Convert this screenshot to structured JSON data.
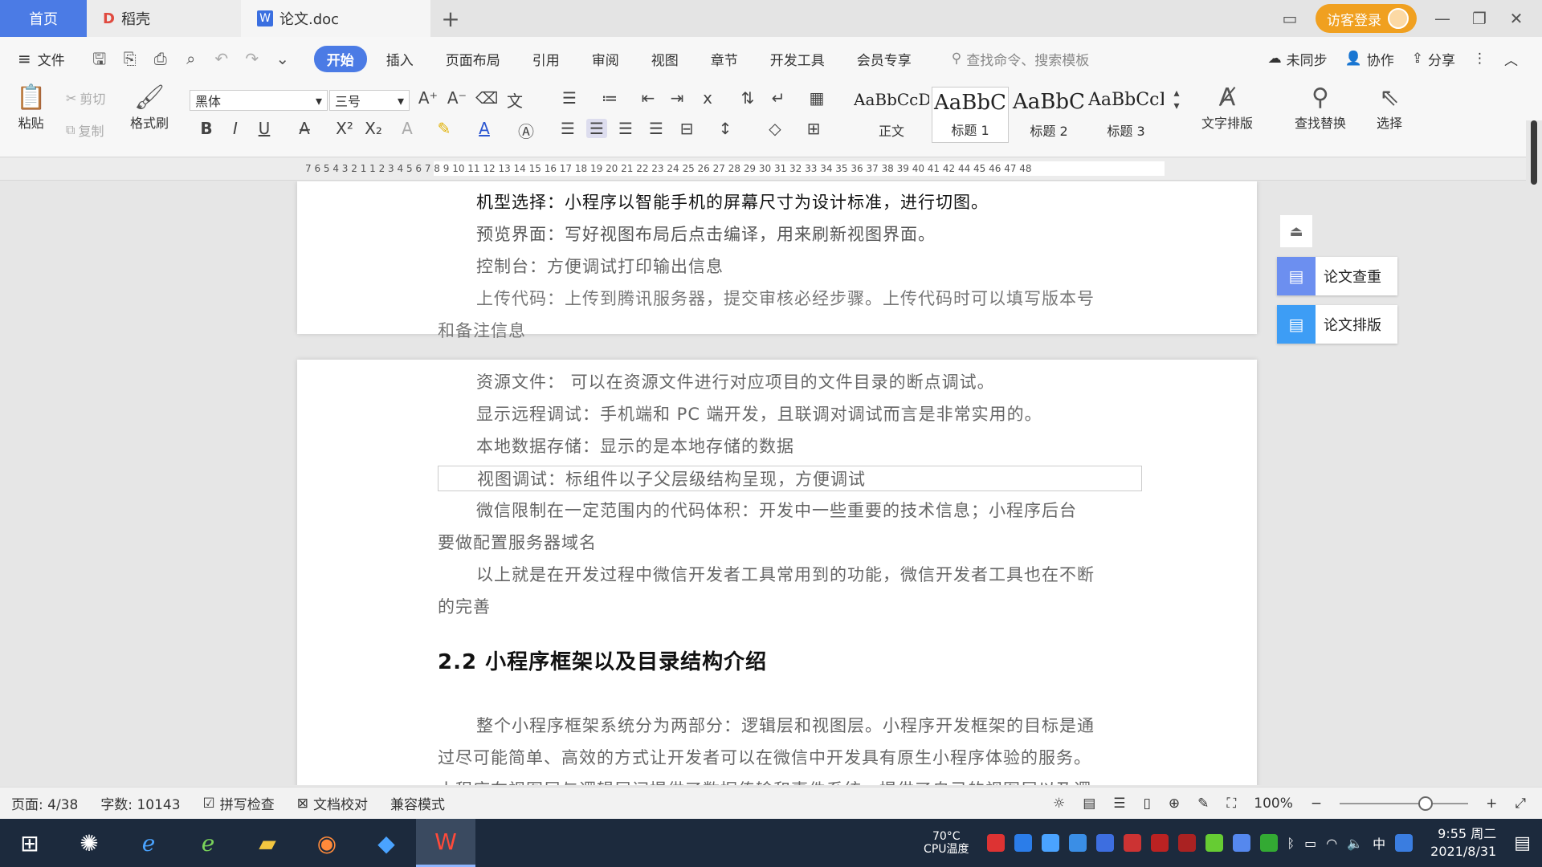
{
  "titlebar": {
    "tabs": [
      {
        "label": "首页"
      },
      {
        "label": "稻壳"
      },
      {
        "label": "论文.doc"
      }
    ],
    "add_tab": "+",
    "login_label": "访客登录"
  },
  "menubar": {
    "file_label": "文件",
    "tabs": [
      "开始",
      "插入",
      "页面布局",
      "引用",
      "审阅",
      "视图",
      "章节",
      "开发工具",
      "会员专享"
    ],
    "search_placeholder": "查找命令、搜索模板",
    "sync_label": "未同步",
    "collab_label": "协作",
    "share_label": "分享"
  },
  "ribbon": {
    "paste": "粘贴",
    "cut": "剪切",
    "copy": "复制",
    "format_painter": "格式刷",
    "font_name": "黑体",
    "font_size": "三号",
    "styles": [
      {
        "preview": "AaBbCcDd",
        "label": "正文"
      },
      {
        "preview": "AaBbC",
        "label": "标题 1"
      },
      {
        "preview": "AaBbC",
        "label": "标题 2"
      },
      {
        "preview": "AaBbCcI",
        "label": "标题 3"
      }
    ],
    "text_layout": "文字排版",
    "find_replace": "查找替换",
    "select": "选择"
  },
  "ruler": {
    "labels": "7  6  5  4  3  2  1     1  2  3  4  5  6  7  8  9  10 11 12 13 14 15 16 17 18 19 20 21 22 23 24 25 26 27 28 29 30 31 32 33 34 35 36 37 38 39 40 41 42     44 45 46 47 48"
  },
  "document": {
    "page1_lines": [
      "机型选择：小程序以智能手机的屏幕尺寸为设计标准，进行切图。",
      "预览界面：写好视图布局后点击编译，用来刷新视图界面。",
      "控制台：方便调试打印输出信息",
      "上传代码：上传到腾讯服务器，提交审核必经步骤。上传代码时可以填写版本号",
      "和备注信息"
    ],
    "page2_lines": [
      "资源文件：    可以在资源文件进行对应项目的文件目录的断点调试。",
      "显示远程调试：手机端和 PC 端开发，且联调对调试而言是非常实用的。",
      "本地数据存储：显示的是本地存储的数据",
      "视图调试：标组件以子父层级结构呈现，方便调试",
      "微信限制在一定范围内的代码体积：开发中一些重要的技术信息；小程序后台",
      "要做配置服务器域名",
      "以上就是在开发过程中微信开发者工具常用到的功能，微信开发者工具也在不断",
      "的完善"
    ],
    "heading": "2.2 小程序框架以及目录结构介绍",
    "para_lines": [
      "整个小程序框架系统分为两部分：逻辑层和视图层。小程序开发框架的目标是通",
      "过尽可能简单、高效的方式让开发者可以在微信中开发具有原生小程序体验的服务。",
      "小程序在视图层与逻辑层间提供了数据传输和事件系统，提供了自己的视图层以及逻"
    ]
  },
  "side_panel": {
    "check_label": "论文查重",
    "layout_label": "论文排版"
  },
  "status": {
    "page": "页面: 4/38",
    "words": "字数: 10143",
    "spell": "拼写检查",
    "proof": "文档校对",
    "compat": "兼容模式",
    "zoom": "100%"
  },
  "taskbar": {
    "cpu_temp": "70°C",
    "cpu_label": "CPU温度",
    "ime": "中",
    "time": "9:55 周二",
    "date": "2021/8/31"
  }
}
